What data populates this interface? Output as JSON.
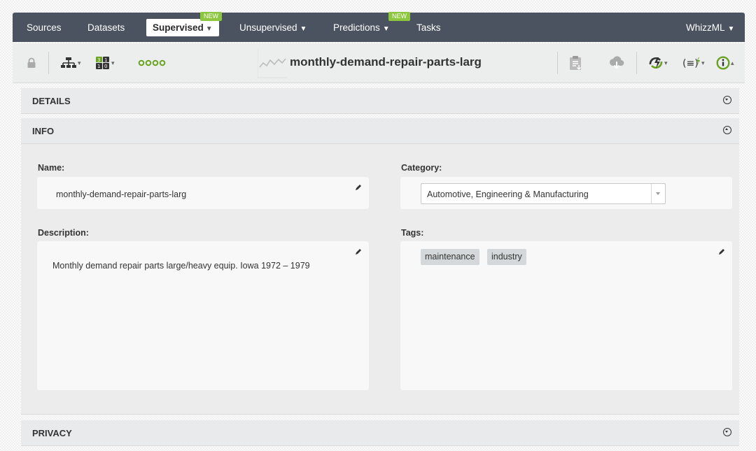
{
  "nav": {
    "items": {
      "sources": "Sources",
      "datasets": "Datasets",
      "supervised": "Supervised",
      "unsupervised": "Unsupervised",
      "predictions": "Predictions",
      "tasks": "Tasks",
      "whizzml": "WhizzML"
    },
    "new_badge": "NEW",
    "caret": "▼",
    "active": "supervised"
  },
  "toolbar": {
    "title": "monthly-demand-repair-parts-larg",
    "icons": [
      "lock-icon",
      "model-tree-icon",
      "model-summary-icon",
      "more-dots-icon",
      "sparkline-icon",
      "report-icon",
      "cloud-download-icon",
      "actions-icon",
      "formula-icon",
      "info-icon"
    ]
  },
  "sections": {
    "details": "DETAILS",
    "info": "INFO",
    "privacy": "PRIVACY"
  },
  "info": {
    "name_label": "Name:",
    "name_value": "monthly-demand-repair-parts-larg",
    "category_label": "Category:",
    "category_value": "Automotive, Engineering & Manufacturing",
    "description_label": "Description:",
    "description_value": "Monthly demand repair parts large/heavy equip. Iowa 1972 – 1979",
    "tags_label": "Tags:",
    "tags": [
      "maintenance",
      "industry"
    ]
  },
  "colors": {
    "nav_bg": "#4b5360",
    "accent_green": "#6aa320",
    "badge_green": "#8dc63f",
    "section_bg": "#e9eaeb"
  }
}
